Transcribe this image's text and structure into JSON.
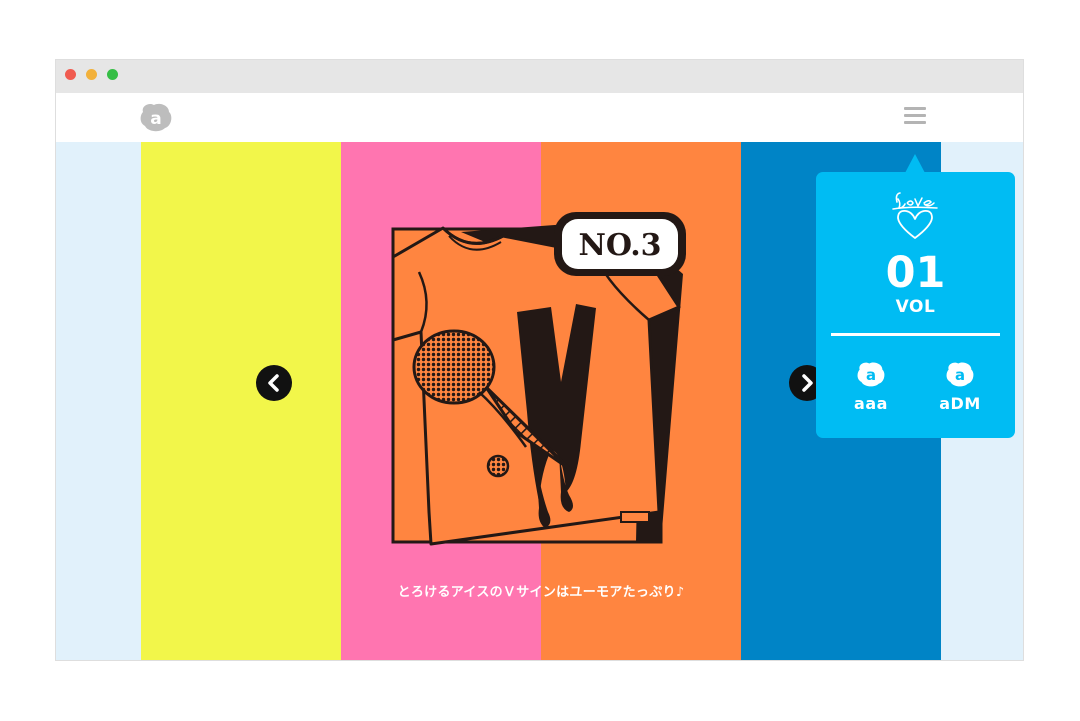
{
  "colors": {
    "background": "#e1f1fb",
    "stripe_yellow": "#f2f64a",
    "stripe_pink": "#ff75b0",
    "stripe_orange": "#ff8540",
    "stripe_blue": "#0084c6",
    "popup": "#00bcf3",
    "ink": "#231815"
  },
  "header": {
    "logo_icon": "a-logo-icon",
    "menu_icon": "hamburger-menu-icon"
  },
  "slider": {
    "badge_text": "NO.3",
    "caption": "とろけるアイスのＶサインはユーモアたっぷり♪",
    "prev_icon": "chevron-left-icon",
    "next_icon": "chevron-right-icon"
  },
  "menu_popup": {
    "love_icon": "love-heart-icon",
    "vol_number": "01",
    "vol_label": "VOL",
    "links": [
      {
        "label": "aaa",
        "icon": "a-logo-icon"
      },
      {
        "label": "aDM",
        "icon": "a-logo-icon"
      }
    ]
  }
}
